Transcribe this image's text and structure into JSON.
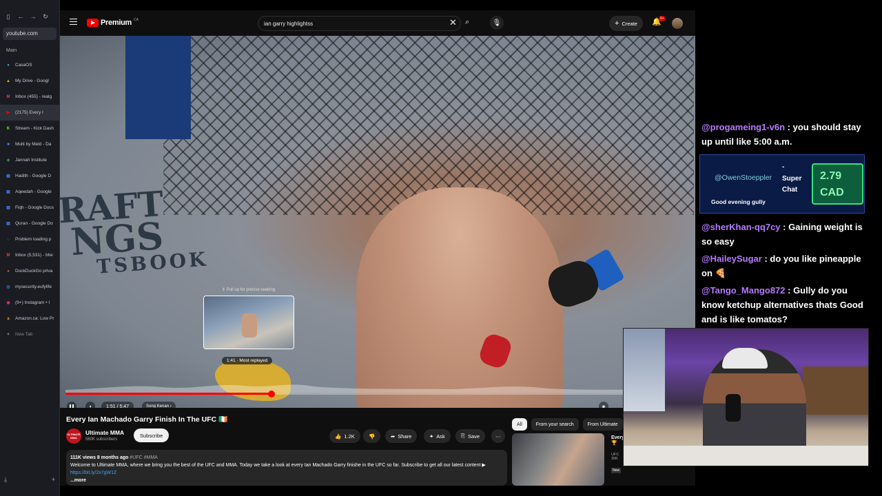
{
  "browser": {
    "url": "youtube.com",
    "section_label": "Main",
    "new_tab_label": "New Tab",
    "tabs": [
      {
        "label": "CasaOS",
        "color": "#3aa7e6",
        "glyph": "●"
      },
      {
        "label": "My Drive - Googl",
        "color": "#f4b400",
        "glyph": "▲"
      },
      {
        "label": "Inbox (455) - realg",
        "color": "#ea4335",
        "glyph": "M"
      },
      {
        "label": "(2175) Every I",
        "color": "#ff0000",
        "glyph": "▶",
        "active": true
      },
      {
        "label": "Stream - Kick Dash",
        "color": "#53fc18",
        "glyph": "K"
      },
      {
        "label": "Multi by Meld - Da",
        "color": "#4a7cf7",
        "glyph": "■"
      },
      {
        "label": "Jannah Institute",
        "color": "#2e8b57",
        "glyph": "◆"
      },
      {
        "label": "Hadith - Google D",
        "color": "#4285f4",
        "glyph": "▤"
      },
      {
        "label": "Aqeedah - Google",
        "color": "#4285f4",
        "glyph": "▤"
      },
      {
        "label": "Fiqh - Google Docs",
        "color": "#4285f4",
        "glyph": "▤"
      },
      {
        "label": "Quran - Google Do",
        "color": "#4285f4",
        "glyph": "▤"
      },
      {
        "label": "Problem loading p",
        "color": "#777777",
        "glyph": "○"
      },
      {
        "label": "Inbox (5,531) - bhe",
        "color": "#ea4335",
        "glyph": "M"
      },
      {
        "label": "DuckDuckGo priva",
        "color": "#de5833",
        "glyph": "●"
      },
      {
        "label": "mysecurity.eufylife",
        "color": "#3b82f6",
        "glyph": "◎"
      },
      {
        "label": "(9+) Instagram • I",
        "color": "#e1306c",
        "glyph": "◉"
      },
      {
        "label": "Amazon.ca: Low Pr",
        "color": "#ff9900",
        "glyph": "a"
      }
    ]
  },
  "youtube": {
    "logo_text": "Premium",
    "logo_region": "CA",
    "search_query": "ian garry highlightss",
    "create_label": "Create",
    "notif_badge": "9+",
    "video": {
      "seek_hint": "⇕ Pull up for precise seeking",
      "preview_time": "1:41 · Most replayed",
      "progress": 0.33,
      "time": "1:51 / 5:47",
      "chapter": "Song Kenan ›",
      "mat_lines": [
        "RAFT",
        "NGS",
        "TSBOOK"
      ]
    },
    "title": "Every Ian Machado Garry Finish In The UFC 🇮🇪",
    "channel": {
      "name": "Ultimate MMA",
      "subscribers": "560K subscribers",
      "avatar_text": "ULTIMATE MMA"
    },
    "subscribe_label": "Subscribe",
    "actions": {
      "likes": "1.2K",
      "share": "Share",
      "ask": "Ask",
      "save": "Save"
    },
    "description": {
      "meta": "111K views  8 months ago",
      "tags": "#UFC #MMA",
      "text": "Welcome to Ultimate MMA, where we bring you the best of the UFC and MMA. Today we take a look at every Ian Machado Garry finishe in the UFC so far. Subscribe to get all our latest content ▶ ",
      "link": "https://bit.ly/2x7gW1Z",
      "more": "...more"
    },
    "chips": [
      "All",
      "From your search",
      "From Ultimate"
    ],
    "recommendation": {
      "title": "Every",
      "emoji": "🏆",
      "sub1": "UFC",
      "sub2": "39K",
      "badge": "New"
    }
  },
  "chat": [
    {
      "user": "@progameing1-v6n",
      "text": " : you should stay up until like 5:00 a.m."
    },
    {
      "user": "@sherKhan-qq7cy",
      "text": " : Gaining weight is so easy"
    },
    {
      "user": "@HaileySugar",
      "text": " : do you like pineapple on 🍕"
    },
    {
      "user": "@Tango_Mango872",
      "text": " : Gully do you know ketchup alternatives thats Good and is like tomatos?"
    }
  ],
  "superchat": {
    "user": "@OwenStoeppler",
    "dash": "-",
    "label_line1": "Super",
    "label_line2": "Chat",
    "amount_line1": "2.79",
    "amount_line2": "CAD",
    "message": "Good evening gully"
  },
  "colors": {
    "youtube_red": "#ff0000",
    "chat_user": "#b77bff",
    "superchat_bg": "#0a1b45",
    "superchat_amount": "#39e27a"
  }
}
